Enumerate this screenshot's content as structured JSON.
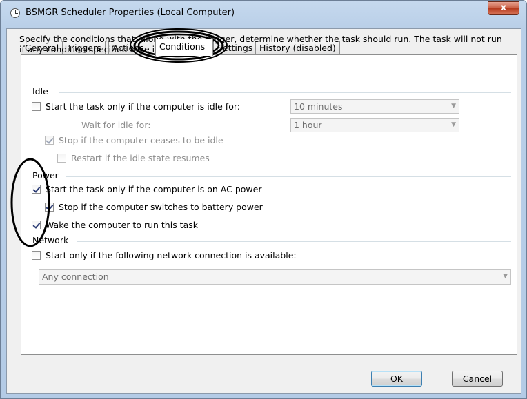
{
  "window": {
    "title": "BSMGR Scheduler Properties (Local Computer)",
    "close_label": "x"
  },
  "tabs": [
    {
      "label": "General"
    },
    {
      "label": "Triggers"
    },
    {
      "label": "Actions"
    },
    {
      "label": "Conditions"
    },
    {
      "label": "Settings"
    },
    {
      "label": "History (disabled)"
    }
  ],
  "description": "Specify the conditions that, along with the trigger, determine whether the task should run.  The task will not run  if any condition specified here is not true.",
  "idle": {
    "group_label": "Idle",
    "start_if_idle": {
      "label": "Start the task only if the computer is idle for:",
      "checked": false
    },
    "idle_duration": "10 minutes",
    "wait_label": "Wait for idle for:",
    "wait_duration": "1 hour",
    "stop_if_ceases": {
      "label": "Stop if the computer ceases to be idle",
      "checked": true
    },
    "restart_if_resumes": {
      "label": "Restart if the idle state resumes",
      "checked": false
    }
  },
  "power": {
    "group_label": "Power",
    "ac_power": {
      "label": "Start the task only if the computer is on AC power",
      "checked": true
    },
    "battery_stop": {
      "label": "Stop if the computer switches to battery power",
      "checked": true
    },
    "wake": {
      "label": "Wake the computer to run this task",
      "checked": true
    }
  },
  "network": {
    "group_label": "Network",
    "start_if_network": {
      "label": "Start only if the following network connection is available:",
      "checked": false
    },
    "connection": "Any connection"
  },
  "buttons": {
    "ok": "OK",
    "cancel": "Cancel"
  }
}
